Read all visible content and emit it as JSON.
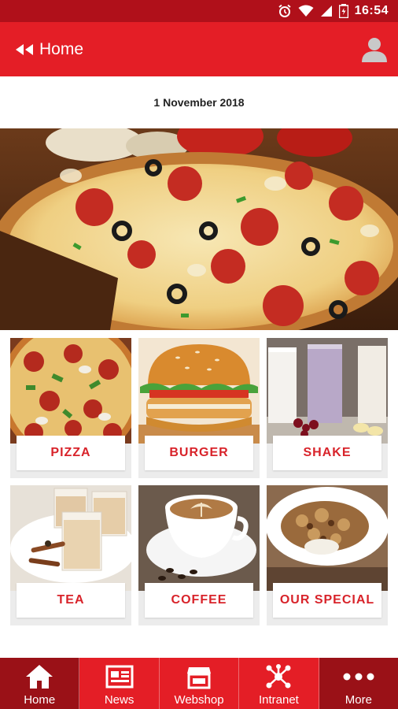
{
  "status_bar": {
    "time": "16:54",
    "icons": [
      "alarm-icon",
      "wifi-icon",
      "signal-icon",
      "battery-icon"
    ]
  },
  "app_bar": {
    "title": "Home",
    "back_icon": "rewind-back-icon",
    "avatar_icon": "user-avatar-icon"
  },
  "date": "1 November 2018",
  "hero": {
    "image": "pizza-hero-image"
  },
  "categories": [
    {
      "label": "PIZZA",
      "image": "pizza-image"
    },
    {
      "label": "BURGER",
      "image": "burger-image"
    },
    {
      "label": "SHAKE",
      "image": "shake-image"
    },
    {
      "label": "TEA",
      "image": "tea-image"
    },
    {
      "label": "COFFEE",
      "image": "coffee-image"
    },
    {
      "label": "OUR SPECIAL",
      "image": "special-dish-image"
    }
  ],
  "bottom_nav": {
    "items": [
      {
        "label": "Home",
        "icon": "home-icon",
        "active": true
      },
      {
        "label": "News",
        "icon": "newspaper-icon",
        "active": false
      },
      {
        "label": "Webshop",
        "icon": "shop-icon",
        "active": false
      },
      {
        "label": "Intranet",
        "icon": "network-icon",
        "active": false
      },
      {
        "label": "More",
        "icon": "more-dots-icon",
        "active": false
      }
    ]
  },
  "colors": {
    "primary": "#e41e26",
    "status_bar": "#b0101a",
    "nav_dark": "#9a1117",
    "label_red": "#d8232a",
    "tile_bg": "#ececec"
  }
}
